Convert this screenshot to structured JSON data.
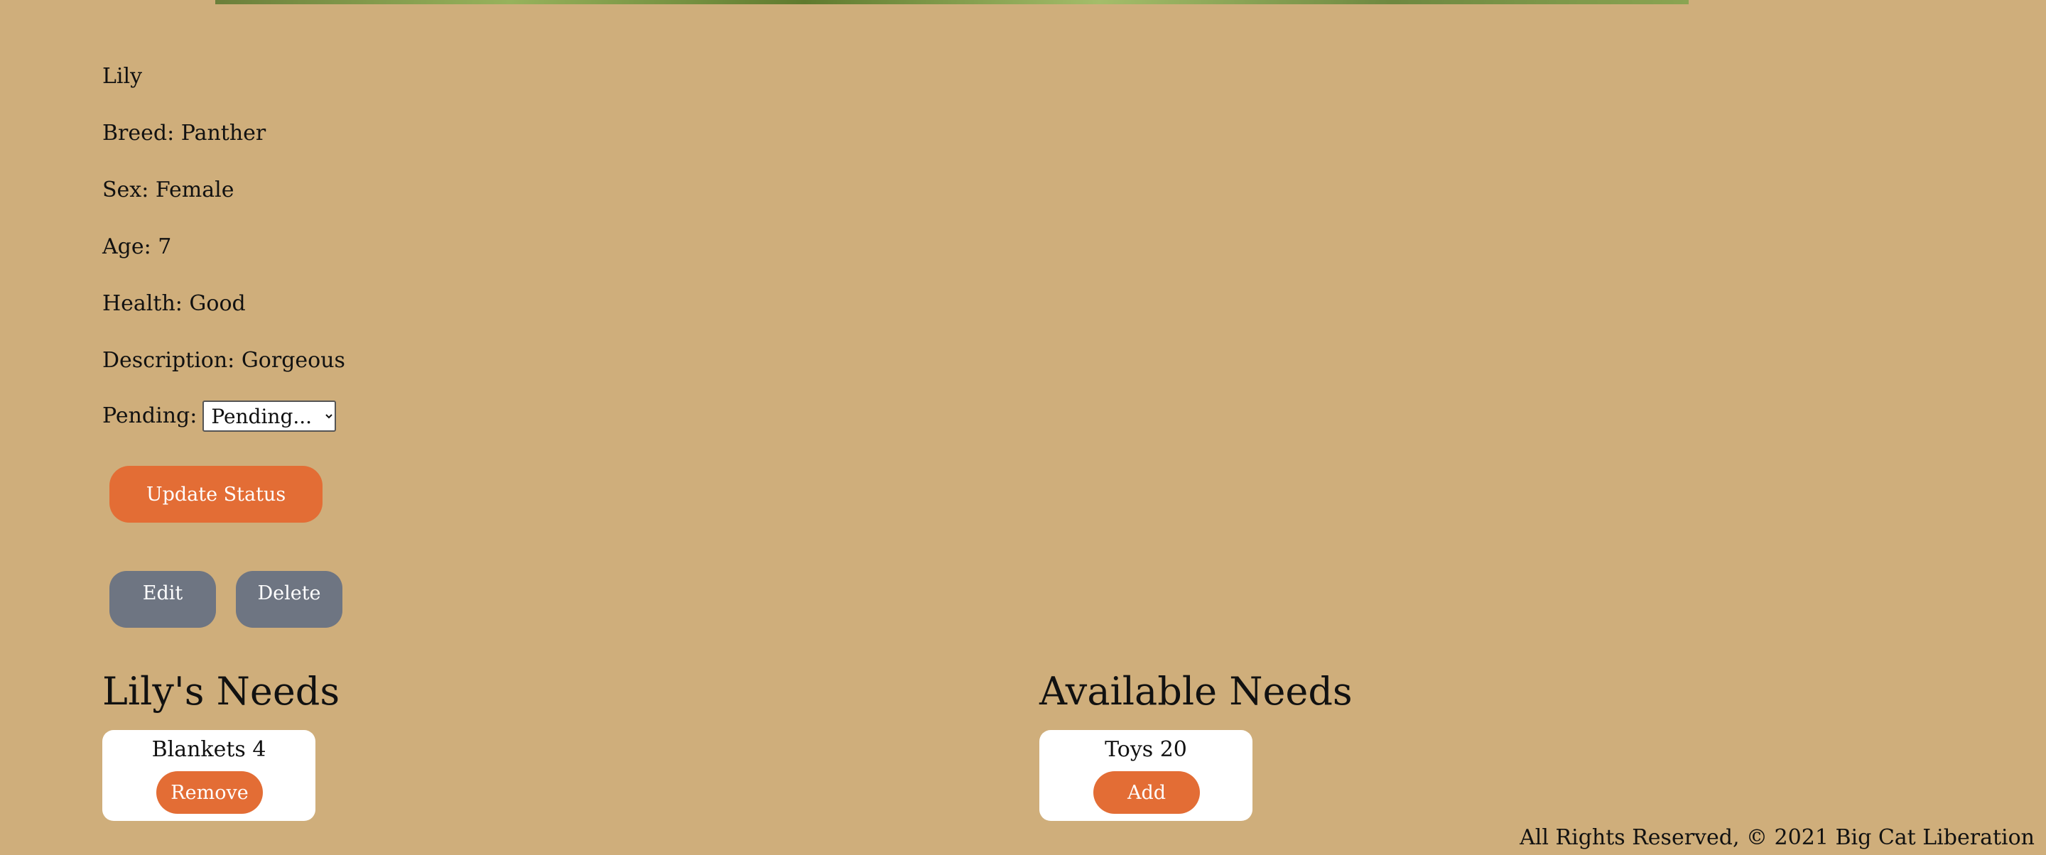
{
  "animal": {
    "name": "Lily",
    "breed": "Breed: Panther",
    "sex": "Sex: Female",
    "age": "Age: 7",
    "health": "Health: Good",
    "description": "Description: Gorgeous",
    "pending_label": "Pending:",
    "pending_selected": "Pending..."
  },
  "actions": {
    "update_status": "Update Status",
    "edit": "Edit",
    "delete": "Delete"
  },
  "needs": {
    "heading": "Lily's Needs",
    "items": [
      {
        "label": "Blankets 4",
        "button": "Remove"
      }
    ]
  },
  "available_needs": {
    "heading": "Available Needs",
    "items": [
      {
        "label": "Toys 20",
        "button": "Add"
      }
    ]
  },
  "footer": {
    "text": "All Rights Reserved, © 2021 Big Cat Liberation"
  },
  "colors": {
    "background": "#cfae7b",
    "accent_orange": "#e36d35",
    "button_gray": "#6e7582",
    "card_white": "#ffffff"
  }
}
